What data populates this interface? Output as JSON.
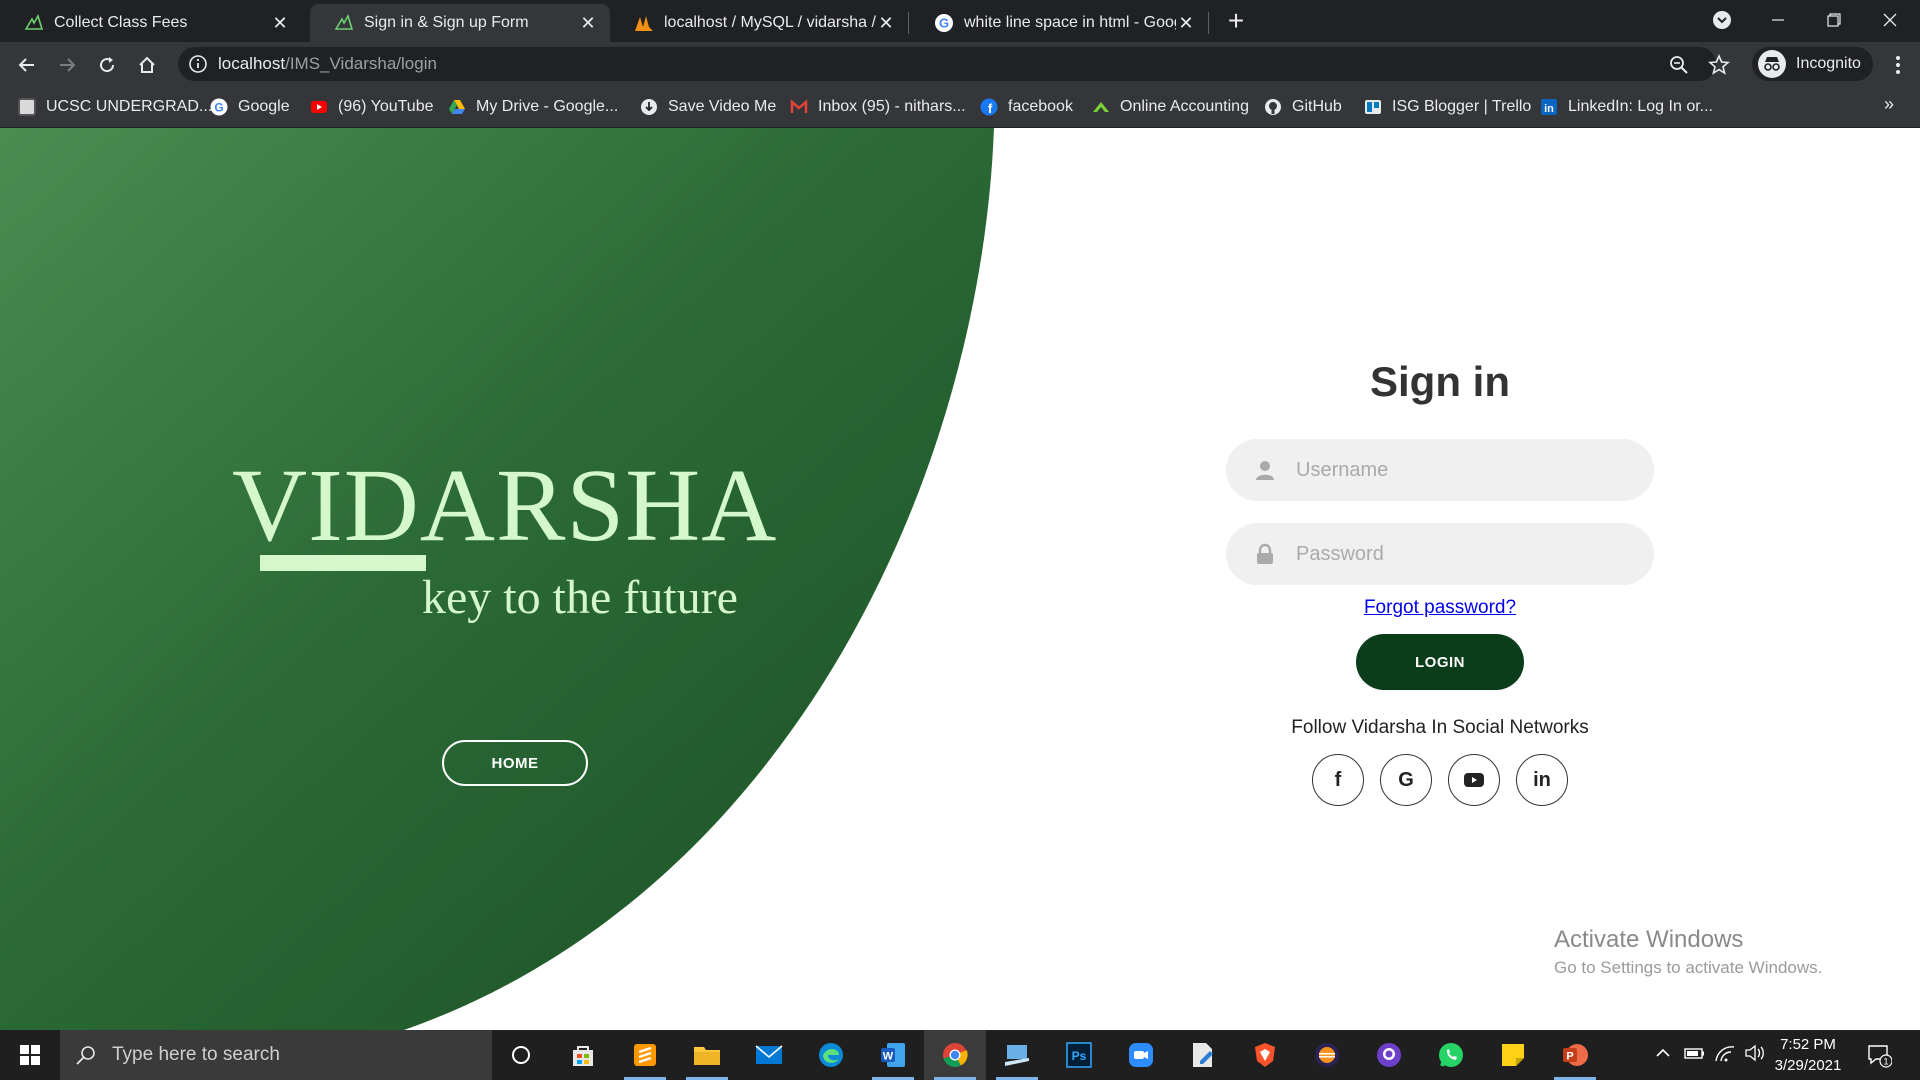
{
  "tabs": [
    {
      "title": "Collect Class Fees",
      "active": false
    },
    {
      "title": "Sign in & Sign up Form",
      "active": true
    },
    {
      "title": "localhost / MySQL / vidarsha / ex",
      "active": false
    },
    {
      "title": "white line space in html - Google",
      "active": false
    }
  ],
  "toolbar": {
    "url_host": "localhost",
    "url_path": "/IMS_Vidarsha/login",
    "incognito_label": "Incognito"
  },
  "bookmarks": [
    {
      "label": "UCSC UNDERGRAD...",
      "icon": "ucsc-icon"
    },
    {
      "label": "Google",
      "icon": "google-icon"
    },
    {
      "label": "(96) YouTube",
      "icon": "youtube-icon"
    },
    {
      "label": "My Drive - Google...",
      "icon": "drive-icon"
    },
    {
      "label": "Save Video Me",
      "icon": "save-video-icon"
    },
    {
      "label": "Inbox (95) - nithars...",
      "icon": "gmail-icon"
    },
    {
      "label": "facebook",
      "icon": "facebook-icon"
    },
    {
      "label": "Online Accounting",
      "icon": "accounting-icon"
    },
    {
      "label": "GitHub",
      "icon": "github-icon"
    },
    {
      "label": "ISG Blogger | Trello",
      "icon": "trello-icon"
    },
    {
      "label": "LinkedIn: Log In or...",
      "icon": "linkedin-icon"
    }
  ],
  "hero": {
    "brand": "VIDARSHA",
    "tagline": "key to the future",
    "home_label": "HOME"
  },
  "signin": {
    "title": "Sign in",
    "username_placeholder": "Username",
    "password_placeholder": "Password",
    "forgot_label": "Forgot password?",
    "login_label": "LOGIN",
    "follow_text": "Follow Vidarsha In Social Networks",
    "social": [
      {
        "glyph": "f",
        "icon": "facebook-icon"
      },
      {
        "glyph": "G",
        "icon": "google-icon"
      },
      {
        "glyph": "▶",
        "icon": "youtube-icon"
      },
      {
        "glyph": "in",
        "icon": "linkedin-icon"
      }
    ]
  },
  "watermark": {
    "title": "Activate Windows",
    "subtitle": "Go to Settings to activate Windows."
  },
  "taskbar": {
    "search_placeholder": "Type here to search",
    "time": "7:52 PM",
    "date": "3/29/2021",
    "notification_count": "1"
  },
  "colors": {
    "green_dark": "#1e5a2c",
    "green_light": "#4a8c52",
    "brand_text": "#d4f7cc",
    "login_button": "#0b3d1a"
  }
}
